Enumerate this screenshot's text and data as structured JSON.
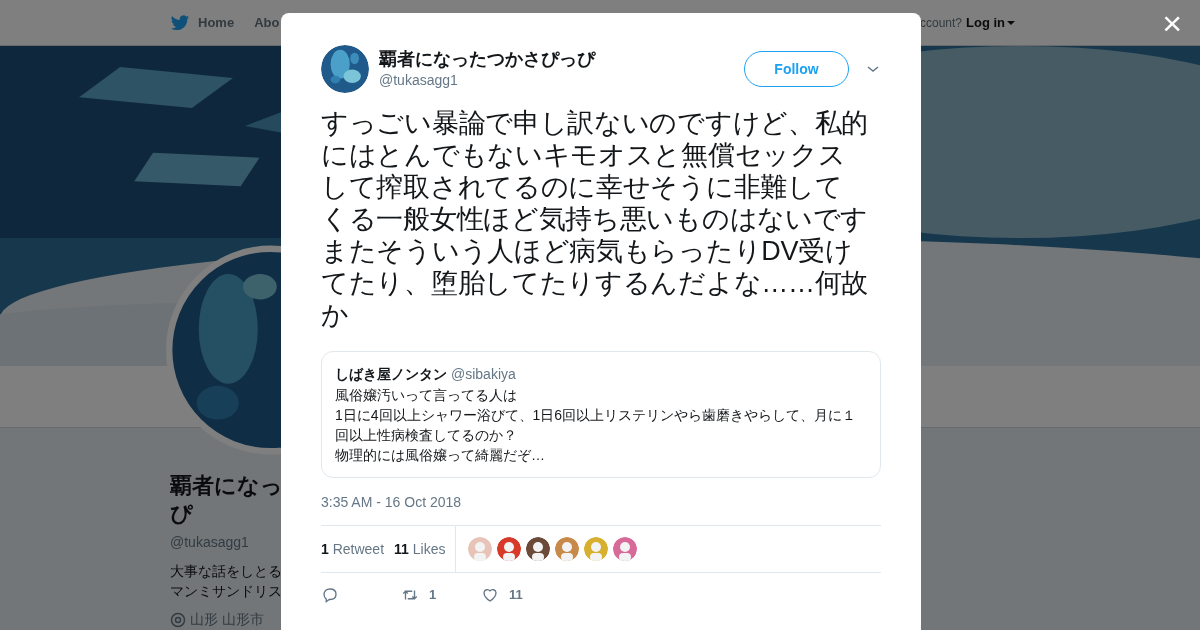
{
  "background_page": {
    "nav": {
      "items": [
        "Home",
        "Abo"
      ],
      "account_prompt": "ccount?",
      "login": "Log in"
    },
    "profile": {
      "name_lines": [
        "覇者になっ",
        "ぴ"
      ],
      "handle": "@tukasagg1",
      "bio_lines": [
        "大事な話をしとる",
        "マンミサンドリス"
      ],
      "location": "山形 山形市"
    }
  },
  "modal": {
    "close": "×",
    "tweet": {
      "author": {
        "name": "覇者になったつかさぴっぴ",
        "handle": "@tukasagg1"
      },
      "follow_button": "Follow",
      "text_lines": [
        "すっごい暴論で申し訳ないのですけど、私的",
        "にはとんでもないキモオスと無償セックス",
        "して搾取されてるのに幸せそうに非難して",
        "くる一般女性ほど気持ち悪いものはないです",
        "またそういう人ほど病気もらったりDV受け",
        "てたり、堕胎してたりするんだよな……何故",
        "か"
      ],
      "quoted": {
        "name": "しばき屋ノンタン",
        "handle": "@sibakiya",
        "lines": [
          "風俗嬢汚いって言ってる人は",
          "1日に4回以上シャワー浴びて、1日6回以上リステリンやら歯磨きやらして、月に１回以上性病検査してるのか？",
          "物理的には風俗嬢って綺麗だぞ…"
        ]
      },
      "timestamp": "3:35 AM - 16 Oct 2018",
      "stats": [
        {
          "count": "1",
          "label": "Retweet"
        },
        {
          "count": "11",
          "label": "Likes"
        }
      ],
      "actions": [
        {
          "kind": "reply"
        },
        {
          "kind": "retweet",
          "count": "1"
        },
        {
          "kind": "like",
          "count": "11"
        }
      ]
    }
  }
}
